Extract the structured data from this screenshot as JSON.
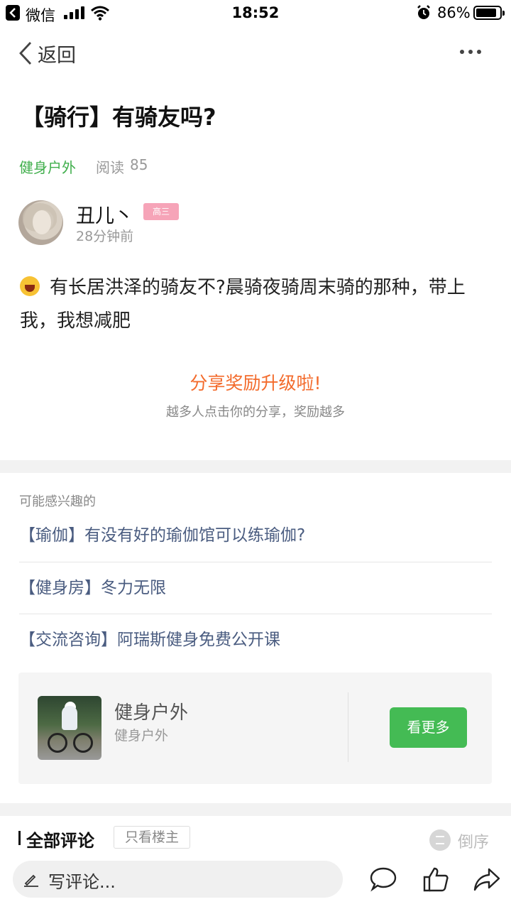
{
  "status_bar": {
    "carrier": "微信",
    "time": "18:52",
    "battery_text": "86%",
    "battery_level": 0.86,
    "icons": [
      "back-to-app-icon",
      "signal-icon",
      "wifi-icon",
      "alarm-icon",
      "battery-icon"
    ]
  },
  "nav": {
    "back_label": "返回",
    "more_icon": "more-dots-icon"
  },
  "post": {
    "title": "【骑行】有骑友吗?",
    "category": "健身户外",
    "read_label": "阅读",
    "read_count": "85",
    "author": {
      "name": "丑儿丶",
      "badge": "高三",
      "time_ago": "28分钟前"
    },
    "body": "有长居洪泽的骑友不?晨骑夜骑周末骑的那种，带上我，我想减肥",
    "emoji": "laughing-emoji"
  },
  "share": {
    "title": "分享奖励升级啦!",
    "subtitle": "越多人点击你的分享，奖励越多"
  },
  "related": {
    "heading": "可能感兴趣的",
    "items": [
      "【瑜伽】有没有好的瑜伽馆可以练瑜伽?",
      "【健身房】冬力无限",
      "【交流咨询】阿瑞斯健身免费公开课"
    ]
  },
  "group_card": {
    "name": "健身户外",
    "subtitle": "健身户外",
    "button": "看更多"
  },
  "comments": {
    "title": "全部评论",
    "only_host": "只看楼主",
    "order": "倒序"
  },
  "bottom_bar": {
    "input_placeholder": "写评论...",
    "icons": [
      "comment-icon",
      "like-icon",
      "share-icon"
    ]
  },
  "colors": {
    "accent_green": "#44bb54",
    "category_green": "#3fae4b",
    "share_orange": "#f36b2c",
    "link_blue": "#4a5c80",
    "badge_pink": "#f6a4b8"
  }
}
